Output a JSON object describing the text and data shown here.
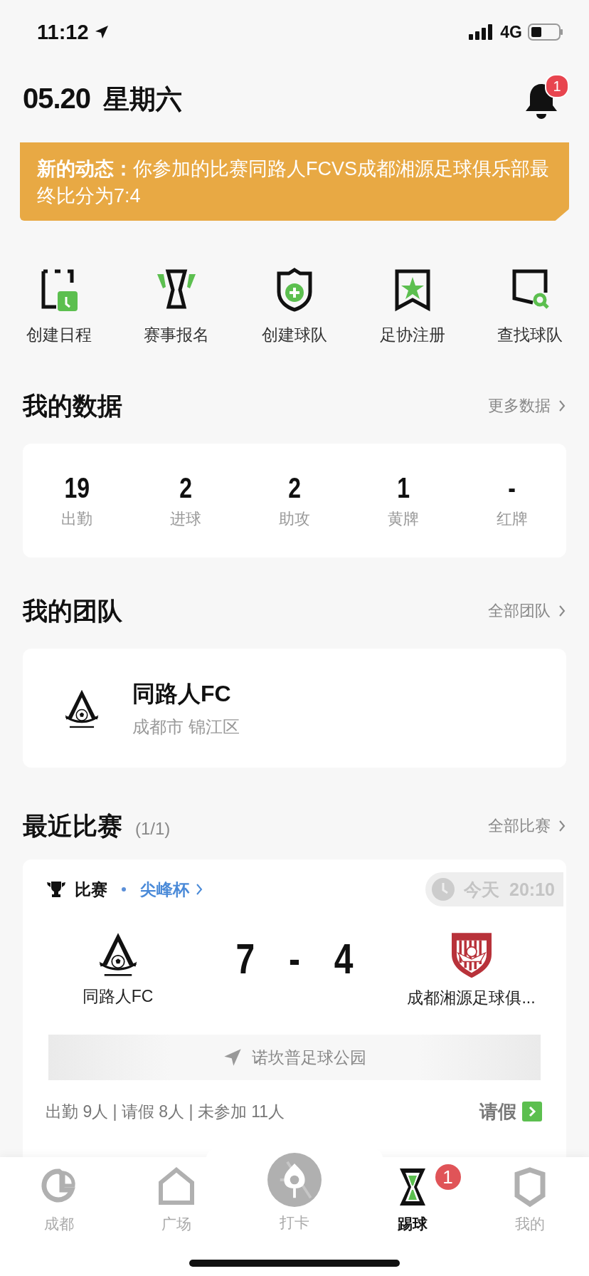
{
  "status_bar": {
    "time": "11:12",
    "network": "4G"
  },
  "header": {
    "date": "05.20",
    "weekday": "星期六",
    "notification_count": "1"
  },
  "banner": {
    "label": "新的动态：",
    "message": "你参加的比赛同路人FCVS成都湘源足球俱乐部最终比分为7:4"
  },
  "shortcuts": [
    {
      "kind": "calendar",
      "label": "创建日程"
    },
    {
      "kind": "trophy",
      "label": "赛事报名"
    },
    {
      "kind": "shield-plus",
      "label": "创建球队"
    },
    {
      "kind": "bookmark-star",
      "label": "足协注册"
    },
    {
      "kind": "shield-search",
      "label": "查找球队"
    }
  ],
  "my_data": {
    "title": "我的数据",
    "more": "更多数据",
    "stats": [
      {
        "value": "19",
        "label": "出勤"
      },
      {
        "value": "2",
        "label": "进球"
      },
      {
        "value": "2",
        "label": "助攻"
      },
      {
        "value": "1",
        "label": "黄牌"
      },
      {
        "value": "-",
        "label": "红牌"
      }
    ]
  },
  "my_team": {
    "title": "我的团队",
    "more": "全部团队",
    "team": {
      "name": "同路人FC",
      "location": "成都市 锦江区"
    }
  },
  "recent_matches": {
    "title": "最近比赛",
    "count": "(1/1)",
    "more": "全部比赛",
    "match": {
      "type": "比赛",
      "cup": "尖峰杯",
      "time": "今天  20:10",
      "home_name": "同路人FC",
      "away_name": "成都湘源足球俱...",
      "home_score": "7",
      "separator": "-",
      "away_score": "4",
      "venue": "诺坎普足球公园",
      "attendance": "出勤 9人 | 请假 8人 | 未参加 11人",
      "leave_button": "请假"
    }
  },
  "tab_bar": [
    {
      "kind": "city",
      "label": "成都",
      "selected": false
    },
    {
      "kind": "plaza",
      "label": "广场",
      "selected": false
    },
    {
      "kind": "checkin",
      "label": "打卡",
      "selected": false
    },
    {
      "kind": "football",
      "label": "踢球",
      "selected": true,
      "badge": "1"
    },
    {
      "kind": "me",
      "label": "我的",
      "selected": false
    }
  ]
}
